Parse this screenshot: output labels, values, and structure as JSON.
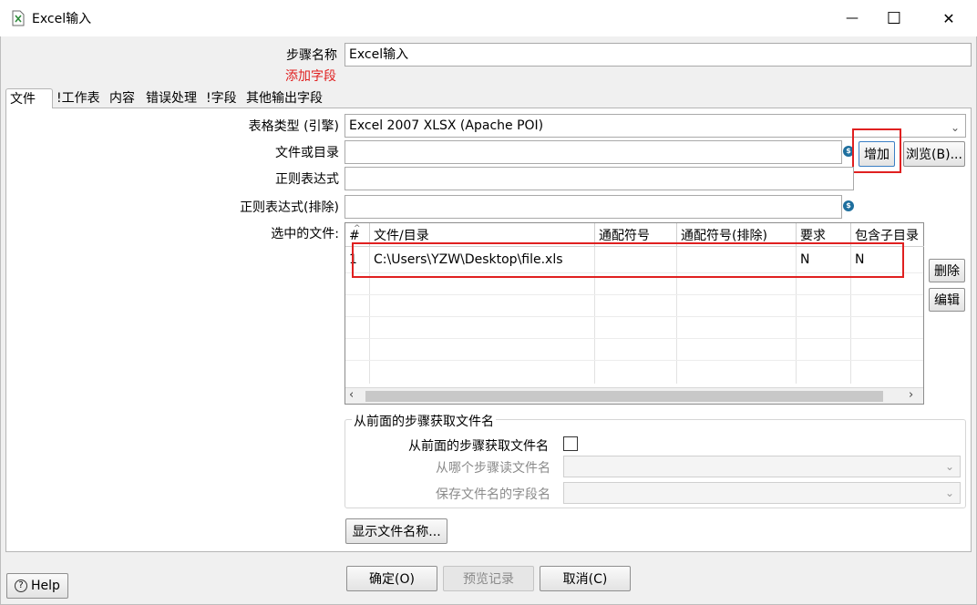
{
  "window": {
    "title": "Excel输入",
    "minimize_glyph": "—",
    "maximize_glyph": "☐",
    "close_glyph": "✕"
  },
  "step": {
    "name_label": "步骤名称",
    "name_value": "Excel输入",
    "add_fields_link": "添加字段"
  },
  "tabs": [
    {
      "label": "文件"
    },
    {
      "label": "!工作表"
    },
    {
      "label": "内容"
    },
    {
      "label": "错误处理"
    },
    {
      "label": "!字段"
    },
    {
      "label": "其他输出字段"
    }
  ],
  "file_tab": {
    "sheet_type_label": "表格类型 (引擎)",
    "sheet_type_value": "Excel 2007 XLSX (Apache POI)",
    "file_or_dir_label": "文件或目录",
    "file_or_dir_value": "",
    "add_button": "增加",
    "browse_button": "浏览(B)...",
    "regex_label": "正则表达式",
    "regex_value": "",
    "regex_exclude_label": "正则表达式(排除)",
    "regex_exclude_value": "",
    "selected_files_label": "选中的文件:",
    "delete_button": "删除",
    "edit_button": "编辑",
    "table": {
      "columns": [
        "#",
        "文件/目录",
        "通配符号",
        "通配符号(排除)",
        "要求",
        "包含子目录"
      ],
      "rows": [
        {
          "num": "1",
          "path": "C:\\Users\\YZW\\Desktop\\file.xls",
          "wildcard": "",
          "wildcard_exclude": "",
          "required": "N",
          "include_subfolders": "N"
        }
      ]
    },
    "from_previous_group": {
      "title": "从前面的步骤获取文件名",
      "checkbox_label": "从前面的步骤获取文件名",
      "checked": false,
      "step_label": "从哪个步骤读文件名",
      "field_label": "保存文件名的字段名"
    },
    "show_filenames_button": "显示文件名称..."
  },
  "footer": {
    "help_button": "Help",
    "ok_button": "确定(O)",
    "preview_button": "预览记录",
    "cancel_button": "取消(C)"
  },
  "colors": {
    "highlight": "#e02020",
    "add_link": "#e02020"
  }
}
